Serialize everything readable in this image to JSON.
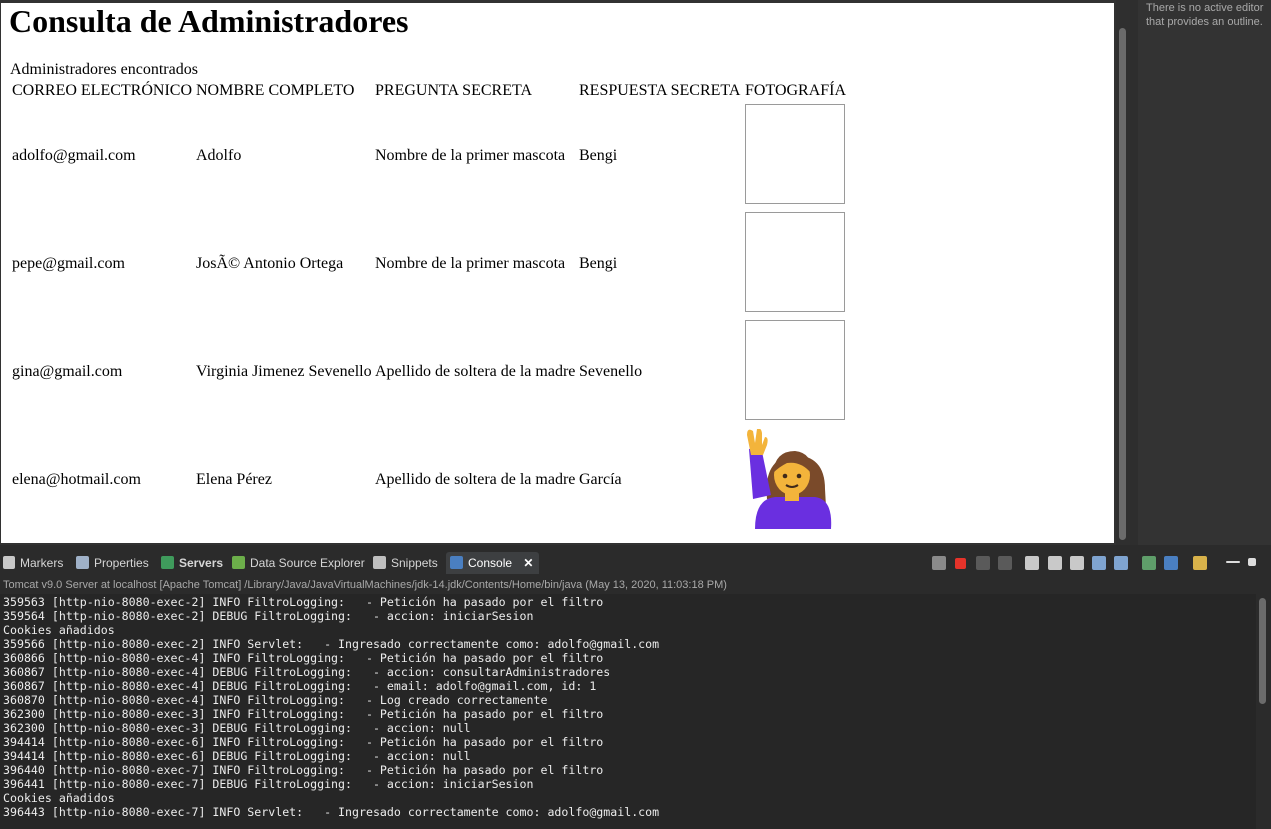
{
  "page": {
    "heading": "Consulta de Administradores",
    "table_caption": "Administradores encontrados",
    "columns": [
      "CORREO ELECTRÓNICO",
      "NOMBRE COMPLETO",
      "PREGUNTA SECRETA",
      "RESPUESTA SECRETA",
      "FOTOGRAFÍA"
    ],
    "rows": [
      {
        "email": "adolfo@gmail.com",
        "name": "Adolfo",
        "question": "Nombre de la primer mascota",
        "answer": "Bengi",
        "photo": "empty"
      },
      {
        "email": "pepe@gmail.com",
        "name": "JosÃ© Antonio Ortega",
        "question": "Nombre de la primer mascota",
        "answer": "Bengi",
        "photo": "empty"
      },
      {
        "email": "gina@gmail.com",
        "name": "Virginia Jimenez Sevenello",
        "question": "Apellido de soltera de la madre",
        "answer": "Sevenello",
        "photo": "empty"
      },
      {
        "email": "elena@hotmail.com",
        "name": "Elena Pérez",
        "question": "Apellido de soltera de la madre",
        "answer": "García",
        "photo": "person-raising-hand-emoji"
      }
    ]
  },
  "outline": {
    "message": "There is no active editor that provides an outline."
  },
  "views": {
    "tabs": [
      "Markers",
      "Properties",
      "Servers",
      "Data Source Explorer",
      "Snippets",
      "Console"
    ],
    "active_tab": "Console"
  },
  "console": {
    "header": "Tomcat v9.0 Server at localhost [Apache Tomcat] /Library/Java/JavaVirtualMachines/jdk-14.jdk/Contents/Home/bin/java  (May 13, 2020, 11:03:18 PM)",
    "lines": [
      "359563 [http-nio-8080-exec-2] INFO FiltroLogging:   - Petición ha pasado por el filtro",
      "359564 [http-nio-8080-exec-2] DEBUG FiltroLogging:   - accion: iniciarSesion",
      "Cookies añadidos",
      "359566 [http-nio-8080-exec-2] INFO Servlet:   - Ingresado correctamente como: adolfo@gmail.com",
      "360866 [http-nio-8080-exec-4] INFO FiltroLogging:   - Petición ha pasado por el filtro",
      "360867 [http-nio-8080-exec-4] DEBUG FiltroLogging:   - accion: consultarAdministradores",
      "360867 [http-nio-8080-exec-4] DEBUG FiltroLogging:   - email: adolfo@gmail.com, id: 1",
      "360870 [http-nio-8080-exec-4] INFO FiltroLogging:   - Log creado correctamente",
      "362300 [http-nio-8080-exec-3] INFO FiltroLogging:   - Petición ha pasado por el filtro",
      "362300 [http-nio-8080-exec-3] DEBUG FiltroLogging:   - accion: null",
      "394414 [http-nio-8080-exec-6] INFO FiltroLogging:   - Petición ha pasado por el filtro",
      "394414 [http-nio-8080-exec-6] DEBUG FiltroLogging:   - accion: null",
      "396440 [http-nio-8080-exec-7] INFO FiltroLogging:   - Petición ha pasado por el filtro",
      "396441 [http-nio-8080-exec-7] DEBUG FiltroLogging:   - accion: iniciarSesion",
      "Cookies añadidos",
      "396443 [http-nio-8080-exec-7] INFO Servlet:   - Ingresado correctamente como: adolfo@gmail.com"
    ]
  },
  "icons": {
    "markers": "markers-icon",
    "properties": "properties-icon",
    "servers": "servers-icon",
    "data_source_explorer": "database-icon",
    "snippets": "snippets-icon",
    "console": "console-icon",
    "close": "close-icon"
  },
  "colors": {
    "stop_button": "#e5332a",
    "ide_background": "#2b2b2b",
    "console_background": "#262626"
  }
}
